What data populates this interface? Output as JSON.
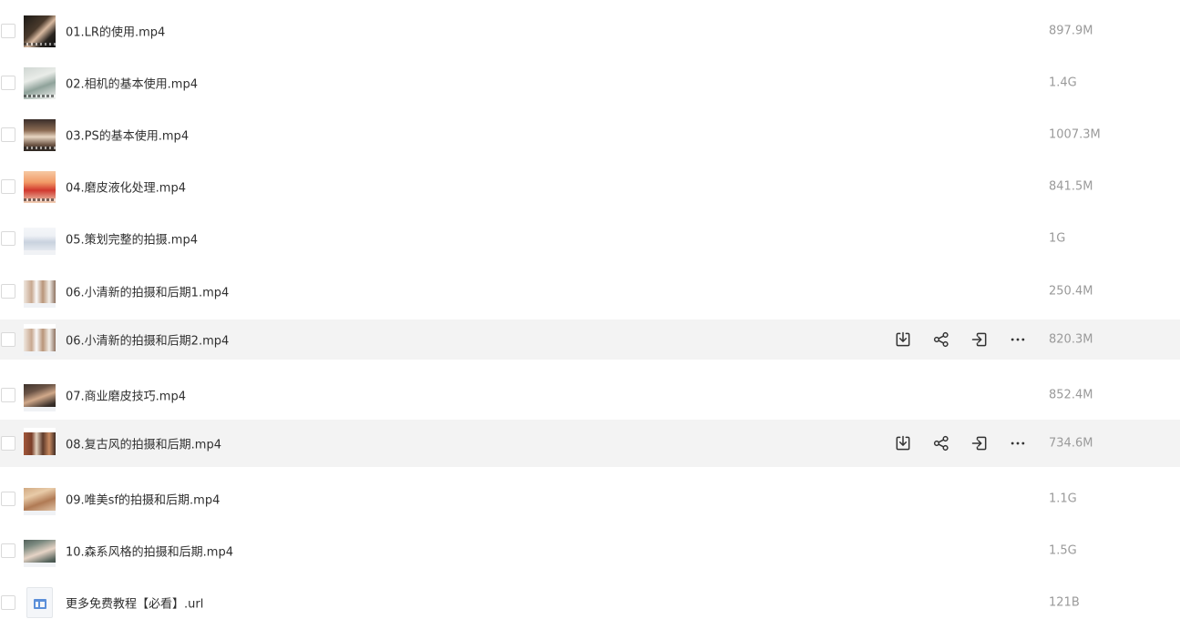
{
  "files": [
    {
      "name": "01.LR的使用.mp4",
      "size": "897.9M",
      "thumb": "photo-portrait-dark"
    },
    {
      "name": "02.相机的基本使用.mp4",
      "size": "1.4G",
      "thumb": "photo-outdoor-light"
    },
    {
      "name": "03.PS的基本使用.mp4",
      "size": "1007.3M",
      "thumb": "photo-portrait-warm"
    },
    {
      "name": "04.磨皮液化处理.mp4",
      "size": "841.5M",
      "thumb": "photo-portrait-red"
    },
    {
      "name": "05.策划完整的拍摄.mp4",
      "size": "1G",
      "thumb": "screen-document"
    },
    {
      "name": "06.小清新的拍摄和后期1.mp4",
      "size": "250.4M",
      "thumb": "screen-collage"
    },
    {
      "name": "06.小清新的拍摄和后期2.mp4",
      "size": "820.3M",
      "thumb": "screen-collage",
      "hovered": true
    },
    {
      "name": "07.商业磨皮技巧.mp4",
      "size": "852.4M",
      "thumb": "photo-portrait-closeup"
    },
    {
      "name": "08.复古风的拍摄和后期.mp4",
      "size": "734.6M",
      "thumb": "screen-retro",
      "hovered": true
    },
    {
      "name": "09.唯美sf的拍摄和后期.mp4",
      "size": "1.1G",
      "thumb": "photo-face-warm"
    },
    {
      "name": "10.森系风格的拍摄和后期.mp4",
      "size": "1.5G",
      "thumb": "photo-face-cool"
    },
    {
      "name": "更多免费教程【必看】.url",
      "size": "121B",
      "thumb": "url-file-icon"
    }
  ],
  "row_actions": [
    "download-icon",
    "share-icon",
    "move-icon",
    "more-icon"
  ],
  "colors": {
    "row_hover": "#f3f3f3",
    "name_text": "#2f2f2f",
    "size_text": "#9a9a9a",
    "icon": "#333333",
    "url_icon_accent": "#5b8fd9"
  }
}
